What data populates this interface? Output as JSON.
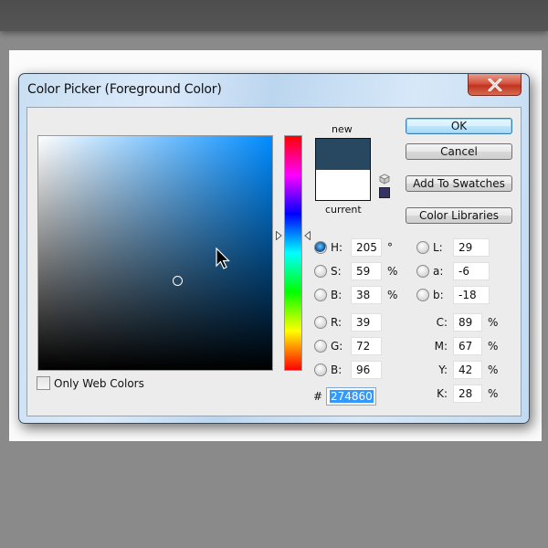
{
  "window": {
    "title": "Color Picker (Foreground Color)",
    "close_icon": "close-x-icon"
  },
  "colors": {
    "new_color": "#274860",
    "current_color": "#ffffff",
    "websafe_color": "#333366",
    "field_hue_color": "#008cff"
  },
  "preview": {
    "new_label": "new",
    "current_label": "current"
  },
  "buttons": {
    "ok": "OK",
    "cancel": "Cancel",
    "add_to_swatches": "Add To Swatches",
    "color_libraries": "Color Libraries"
  },
  "hsb": [
    {
      "label": "H:",
      "value": "205",
      "unit": "°",
      "selected": true
    },
    {
      "label": "S:",
      "value": "59",
      "unit": "%",
      "selected": false
    },
    {
      "label": "B:",
      "value": "38",
      "unit": "%",
      "selected": false
    }
  ],
  "rgb": [
    {
      "label": "R:",
      "value": "39",
      "selected": false
    },
    {
      "label": "G:",
      "value": "72",
      "selected": false
    },
    {
      "label": "B:",
      "value": "96",
      "selected": false
    }
  ],
  "lab": [
    {
      "label": "L:",
      "value": "29",
      "selected": false
    },
    {
      "label": "a:",
      "value": "-6",
      "selected": false
    },
    {
      "label": "b:",
      "value": "-18",
      "selected": false
    }
  ],
  "cmyk": [
    {
      "label": "C:",
      "value": "89",
      "unit": "%"
    },
    {
      "label": "M:",
      "value": "67",
      "unit": "%"
    },
    {
      "label": "Y:",
      "value": "42",
      "unit": "%"
    },
    {
      "label": "K:",
      "value": "28",
      "unit": "%"
    }
  ],
  "hex": {
    "hash": "#",
    "value": "274860"
  },
  "only_web_colors": {
    "label": "Only Web Colors",
    "checked": false
  }
}
